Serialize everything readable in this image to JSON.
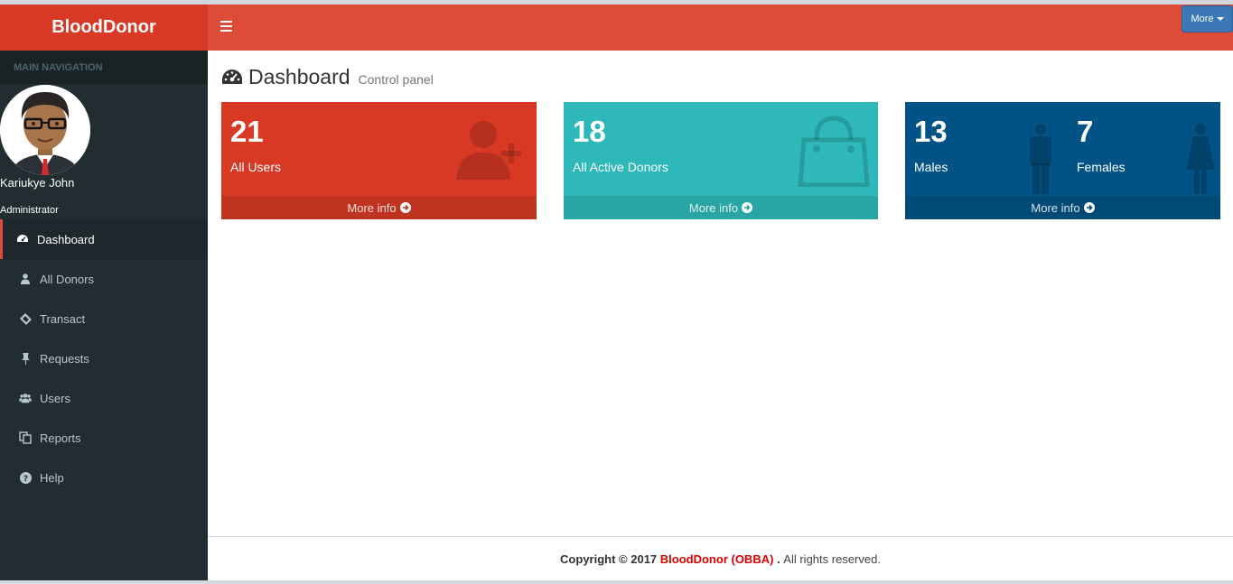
{
  "header": {
    "logo": "BloodDonor",
    "more_label": "More",
    "accent": "#dd4b39"
  },
  "sidebar": {
    "section_label": "MAIN NAVIGATION",
    "user_name": "Kariukye John",
    "user_role": "Administrator",
    "items": [
      {
        "label": "Dashboard",
        "icon": "dashboard-icon"
      },
      {
        "label": "All Donors",
        "icon": "user-icon"
      },
      {
        "label": "Transact",
        "icon": "ticket-icon"
      },
      {
        "label": "Requests",
        "icon": "pin-icon"
      },
      {
        "label": "Users",
        "icon": "users-icon"
      },
      {
        "label": "Reports",
        "icon": "copy-icon"
      },
      {
        "label": "Help",
        "icon": "question-circle-icon"
      }
    ]
  },
  "main": {
    "title": "Dashboard",
    "subtitle": "Control panel",
    "boxes": [
      {
        "value": "21",
        "label": "All Users",
        "more": "More info",
        "color": "#dd4b39",
        "icon": "user-plus-icon"
      },
      {
        "value": "18",
        "label": "All Active Donors",
        "more": "More info",
        "color": "#00c0ef",
        "icon": "shopping-bag-icon"
      },
      {
        "value": "13",
        "label": "Males",
        "value2": "7",
        "label2": "Females",
        "more": "More info",
        "color": "#005384",
        "icon": "male-female-icon"
      }
    ]
  },
  "footer": {
    "prefix": "Copyright © 2017",
    "brand": "BloodDonor (OBBA)",
    "dot": ".",
    "suffix": "All rights reserved."
  }
}
